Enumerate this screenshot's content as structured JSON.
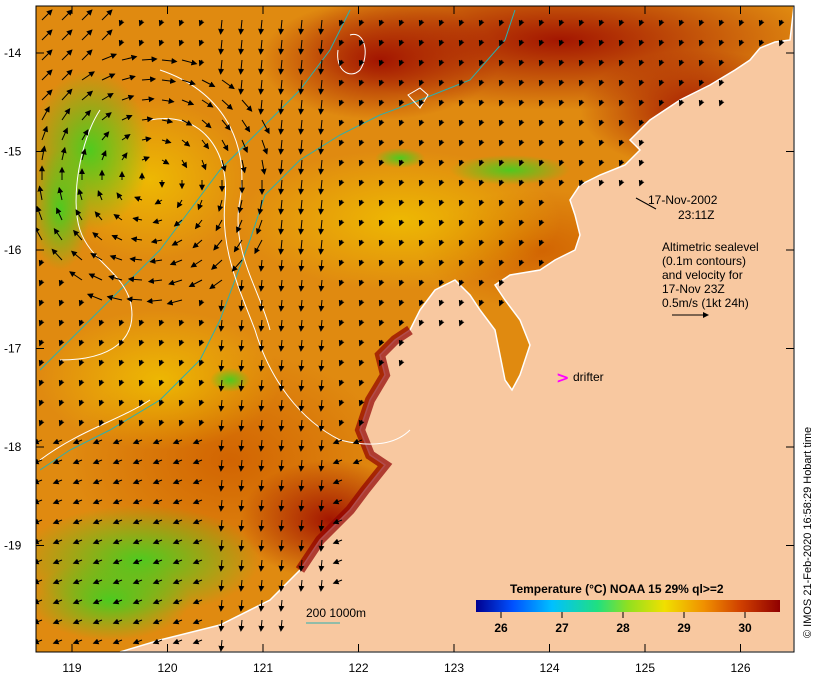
{
  "map": {
    "lon_ticks": [
      "119",
      "120",
      "121",
      "122",
      "123",
      "124",
      "125",
      "126"
    ],
    "lat_ticks": [
      "-14",
      "-15",
      "-16",
      "-17",
      "-18",
      "-19"
    ],
    "colors": {
      "land": "#f8c8a0",
      "coastline": "#ffffff",
      "contour": "#ffffff",
      "isobath": "#2ab0b0",
      "drifter": "#ff00ff"
    }
  },
  "annotations": {
    "date": "17-Nov-2002",
    "time": "23:11Z",
    "altimetry": [
      "Altimetric sealevel",
      "(0.1m contours)",
      "and velocity for",
      "17-Nov 23Z",
      "0.5m/s (1kt 24h)"
    ],
    "drifter_label": "drifter",
    "isobath_label": "200  1000m",
    "credit": "© IMOS 21-Feb-2020 16:58:29 Hobart time"
  },
  "colorbar": {
    "title": "Temperature (°C) NOAA 15 29% ql>=2",
    "labels": [
      "26",
      "27",
      "28",
      "29",
      "30"
    ],
    "colors": [
      "#000090",
      "#0050ff",
      "#00c0ff",
      "#20e080",
      "#90e020",
      "#f0e000",
      "#f09000",
      "#d04000",
      "#900000"
    ]
  }
}
